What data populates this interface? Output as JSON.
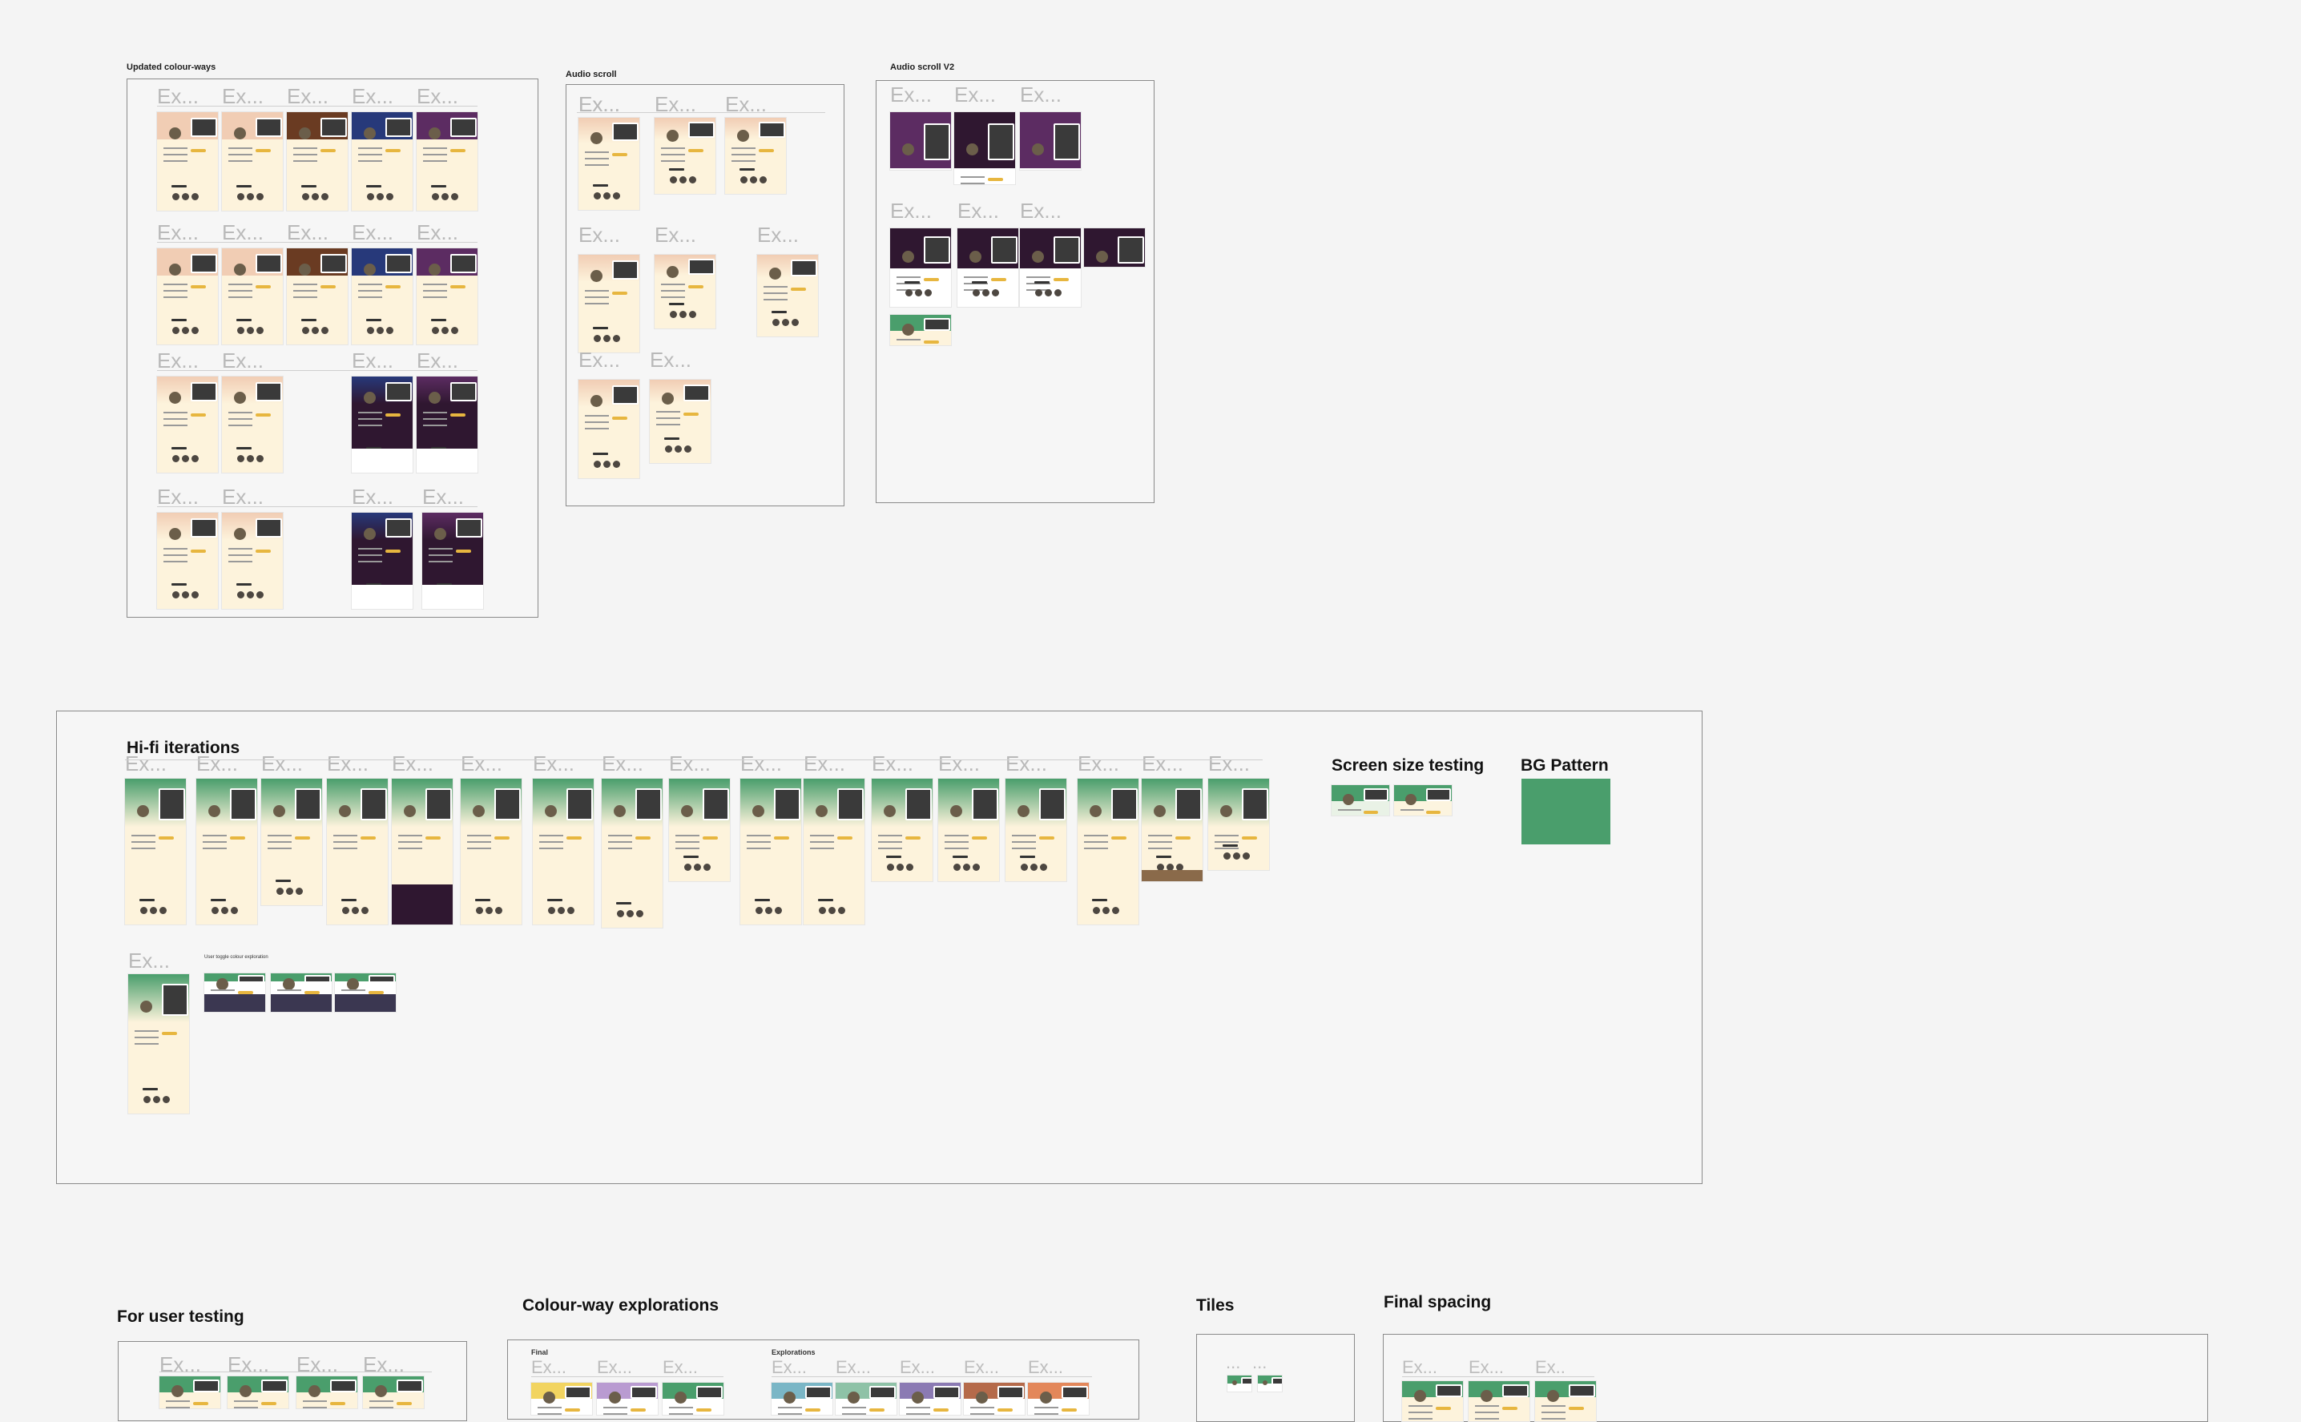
{
  "sections": {
    "updated_colourways": "Updated colour-ways",
    "audio_scroll": "Audio scroll",
    "audio_scroll_v2": "Audio scroll V2",
    "hifi_iterations": "Hi-fi iterations",
    "screen_size_testing": "Screen size testing",
    "bg_pattern": "BG Pattern",
    "for_user_testing": "For user testing",
    "colourway_explorations": "Colour-way explorations",
    "tiles": "Tiles",
    "final_spacing": "Final spacing"
  },
  "labels": {
    "ex": "Ex...",
    "ex_short": "Ex..",
    "ellipsis": "...",
    "final": "Final",
    "explorations": "Explorations",
    "colour_exploration": "User toggle colour exploration"
  },
  "colors": {
    "canvas": "#f4f4f4",
    "frame_border": "#8a8a8a",
    "peach": "#f1cdb4",
    "cream": "#fdf3dc",
    "brown": "#6a3b22",
    "navy": "#27397a",
    "purple": "#5c2c62",
    "dark_purple": "#2f1730",
    "green": "#4a9e6c",
    "accent_yellow": "#e7b63f"
  }
}
